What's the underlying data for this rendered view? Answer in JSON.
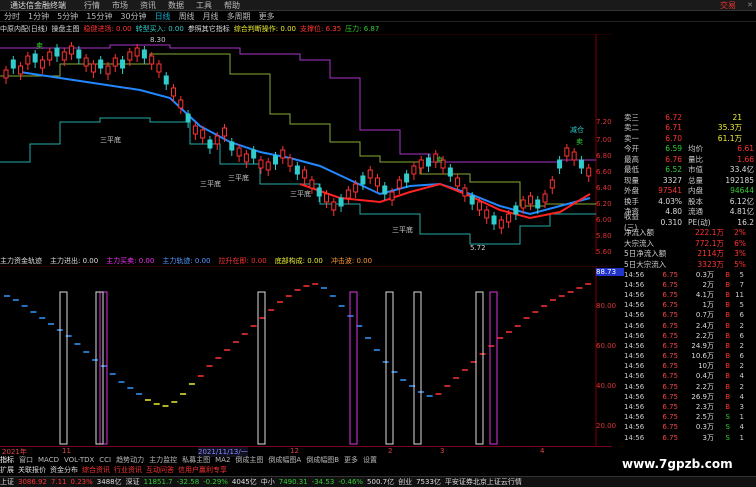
{
  "menu": {
    "app_title": "通达信金融终端",
    "items": [
      "行情",
      "市场",
      "资讯",
      "数据",
      "工具",
      "帮助"
    ],
    "trade": "交易"
  },
  "periods": {
    "items": [
      "分时",
      "1分钟",
      "5分钟",
      "15分钟",
      "30分钟",
      "日线",
      "周线",
      "月线",
      "多周期",
      "更多"
    ],
    "active_index": 5
  },
  "infobar": {
    "stock": "中原内配(日线)",
    "items": [
      {
        "text": "操盘主图",
        "color": "white"
      },
      {
        "text": "稳健进场: 0.00",
        "color": "red"
      },
      {
        "text": "转型买入: 0.00",
        "color": "cyan"
      },
      {
        "text": "参照其它指标",
        "color": "white"
      },
      {
        "text": "综合判断操作: 0.00",
        "color": "yellow"
      },
      {
        "text": "支撑位: 6.35",
        "color": "red"
      },
      {
        "text": "压力: 6.87",
        "color": "green"
      }
    ]
  },
  "price_axis": [
    "7.20",
    "7.00",
    "6.80",
    "6.60",
    "6.40",
    "6.20",
    "6.00",
    "5.80",
    "5.60"
  ],
  "chart_labels": {
    "max_label": "8.30",
    "min_label": "5.72",
    "sell": "卖",
    "buy": "买",
    "platform": "三平底",
    "reduce": "减仓"
  },
  "subchart": {
    "title": "主力资金轨迹",
    "items": [
      {
        "text": "主力进出: 0.00",
        "color": "white"
      },
      {
        "text": "主力买卖: 0.00",
        "color": "magenta"
      },
      {
        "text": "主力轨迹: 0.00",
        "color": "blue"
      },
      {
        "text": "拉升在即: 0.00",
        "color": "red"
      },
      {
        "text": "底部构成: 0.00",
        "color": "yellow"
      },
      {
        "text": "冲击波: 0.00",
        "color": "orange"
      }
    ],
    "axis": [
      "88.73",
      "80.00",
      "60.00",
      "40.00",
      "20.00"
    ]
  },
  "dates": [
    "2021年",
    "11",
    "2021/11/13/一",
    "12",
    "2",
    "3",
    "4"
  ],
  "tabs": [
    "指标",
    "窗口",
    "MACD",
    "VOL-TDX",
    "CCI",
    "趋势动力",
    "主力监控",
    "私募主图",
    "MA2",
    "倒成主图",
    "倒成幅图A",
    "倒成幅图B",
    "更多",
    "设置"
  ],
  "links": [
    "扩展",
    "关联报价",
    "资金分布",
    "综合资讯",
    "行业资讯",
    "互动问答",
    "信用户赢利专享"
  ],
  "status": {
    "items": [
      {
        "name": "上证",
        "value": "3086.92",
        "change": "7.11",
        "pct": "0.23%",
        "amount": "3488亿"
      },
      {
        "name": "深证",
        "value": "11851.7",
        "change": "-32.58",
        "pct": "-0.29%",
        "amount": "4045亿"
      },
      {
        "name": "中小",
        "value": "7490.31",
        "change": "-34.53",
        "pct": "-0.46%",
        "amount": "500.7亿"
      },
      {
        "name": "创业",
        "value": "",
        "change": "",
        "pct": "",
        "amount": "7533亿"
      }
    ],
    "server": "平安证券北京上证云行情"
  },
  "quote": {
    "sell": [
      {
        "label": "卖三",
        "price": "6.72",
        "vol": "21"
      },
      {
        "label": "卖二",
        "price": "6.71",
        "vol": "35.3万"
      },
      {
        "label": "卖一",
        "price": "6.70",
        "vol": "61.1万"
      }
    ],
    "rows": [
      {
        "l1": "今开",
        "v1": "6.59",
        "c1": "green",
        "l2": "均价",
        "v2": "6.61",
        "c2": "red"
      },
      {
        "l1": "最高",
        "v1": "6.76",
        "c1": "red",
        "l2": "量比",
        "v2": "1.66",
        "c2": "red"
      },
      {
        "l1": "最低",
        "v1": "6.52",
        "c1": "green",
        "l2": "市值",
        "v2": "33.4亿",
        "c2": "white"
      },
      {
        "l1": "现量",
        "v1": "3327",
        "c1": "white",
        "l2": "总量",
        "v2": "192185",
        "c2": "white"
      },
      {
        "l1": "外盘",
        "v1": "97541",
        "c1": "red",
        "l2": "内盘",
        "v2": "94644",
        "c2": "green"
      },
      {
        "l1": "换手",
        "v1": "4.03%",
        "c1": "white",
        "l2": "股本",
        "v2": "6.12亿",
        "c2": "white"
      },
      {
        "l1": "净资",
        "v1": "4.80",
        "c1": "white",
        "l2": "流通",
        "v2": "4.81亿",
        "c2": "white"
      },
      {
        "l1": "收益(三)",
        "v1": "0.310",
        "c1": "white",
        "l2": "PE(动)",
        "v2": "16.2",
        "c2": "white"
      }
    ]
  },
  "flows": [
    {
      "label": "净流入额",
      "value": "222.1万",
      "pct": "2%"
    },
    {
      "label": "大宗流入",
      "value": "772.1万",
      "pct": "6%"
    },
    {
      "label": "5日净流入额",
      "value": "2114万",
      "pct": "3%"
    },
    {
      "label": "5日大宗流入",
      "value": "3323万",
      "pct": "5%"
    }
  ],
  "ticks": [
    {
      "t": "14:56",
      "p": "6.75",
      "v": "0.3万",
      "bs": "B",
      "n": "5"
    },
    {
      "t": "14:56",
      "p": "6.75",
      "v": "2万",
      "bs": "B",
      "n": "7"
    },
    {
      "t": "14:56",
      "p": "6.75",
      "v": "4.1万",
      "bs": "B",
      "n": "11"
    },
    {
      "t": "14:56",
      "p": "6.75",
      "v": "1万",
      "bs": "B",
      "n": "5"
    },
    {
      "t": "14:56",
      "p": "6.75",
      "v": "0.7万",
      "bs": "B",
      "n": "6"
    },
    {
      "t": "14:56",
      "p": "6.75",
      "v": "2.4万",
      "bs": "B",
      "n": "2"
    },
    {
      "t": "14:56",
      "p": "6.75",
      "v": "2.2万",
      "bs": "B",
      "n": "6"
    },
    {
      "t": "14:56",
      "p": "6.75",
      "v": "24.9万",
      "bs": "B",
      "n": "2"
    },
    {
      "t": "14:56",
      "p": "6.75",
      "v": "10.6万",
      "bs": "B",
      "n": "6"
    },
    {
      "t": "14:56",
      "p": "6.75",
      "v": "10万",
      "bs": "B",
      "n": "2"
    },
    {
      "t": "14:56",
      "p": "6.75",
      "v": "0.4万",
      "bs": "B",
      "n": "4"
    },
    {
      "t": "14:56",
      "p": "6.75",
      "v": "2.2万",
      "bs": "B",
      "n": "2"
    },
    {
      "t": "14:56",
      "p": "6.75",
      "v": "26.9万",
      "bs": "B",
      "n": "4"
    },
    {
      "t": "14:56",
      "p": "6.75",
      "v": "2.3万",
      "bs": "B",
      "n": "3"
    },
    {
      "t": "14:56",
      "p": "6.75",
      "v": "2.5万",
      "bs": "S",
      "n": "1"
    },
    {
      "t": "14:56",
      "p": "6.75",
      "v": "0.3万",
      "bs": "S",
      "n": "4"
    },
    {
      "t": "14:56",
      "p": "6.75",
      "v": "3万",
      "bs": "S",
      "n": "1"
    }
  ],
  "watermark": "www.7gpzb.com"
}
